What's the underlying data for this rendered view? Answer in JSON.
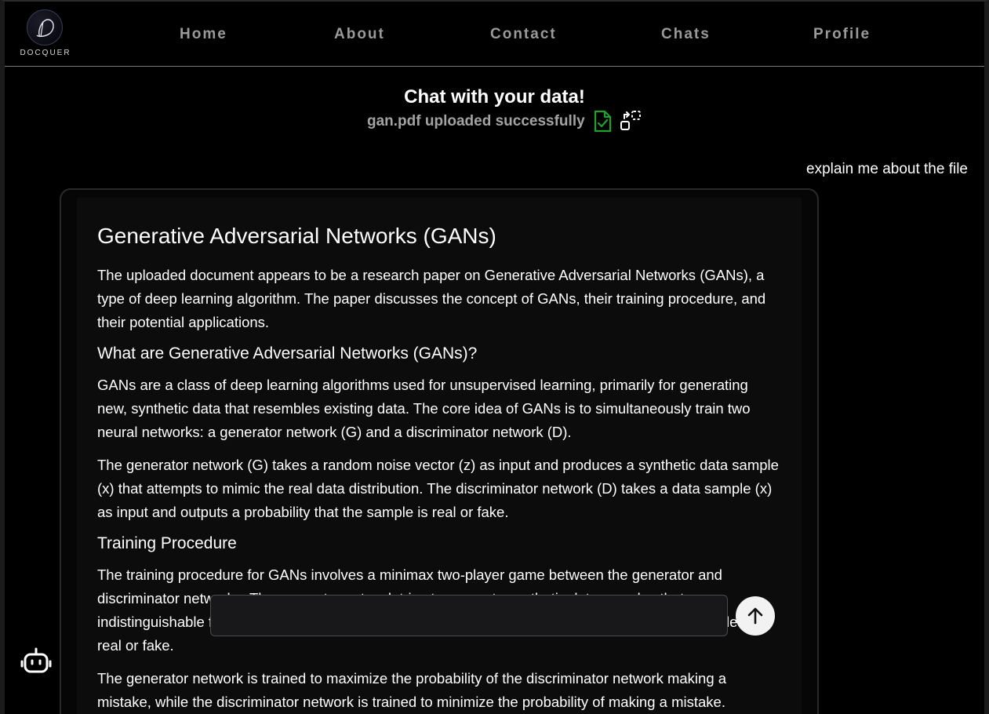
{
  "brand": {
    "name": "DOCQUER"
  },
  "nav": {
    "items": [
      {
        "label": "Home"
      },
      {
        "label": "About"
      },
      {
        "label": "Contact"
      },
      {
        "label": "Chats"
      },
      {
        "label": "Profile"
      }
    ]
  },
  "chat": {
    "title": "Chat with your data!",
    "upload_status": "gan.pdf uploaded successfully",
    "upload_icon": "file-check-icon",
    "change_file_icon": "swap-file-icon",
    "user_message": "explain me about the file",
    "input_placeholder": "",
    "send_icon": "arrow-up-icon",
    "bot_icon": "bot-icon"
  },
  "response": {
    "heading": "Generative Adversarial Networks (GANs)",
    "intro": "The uploaded document appears to be a research paper on Generative Adversarial Networks (GANs), a type of deep learning algorithm. The paper discusses the concept of GANs, their training procedure, and their potential applications.",
    "section1_title": "What are Generative Adversarial Networks (GANs)?",
    "section1_p1": "GANs are a class of deep learning algorithms used for unsupervised learning, primarily for generating new, synthetic data that resembles existing data. The core idea of GANs is to simultaneously train two neural networks: a generator network (G) and a discriminator network (D).",
    "section1_p2": "The generator network (G) takes a random noise vector (z) as input and produces a synthetic data sample (x) that attempts to mimic the real data distribution. The discriminator network (D) takes a data sample (x) as input and outputs a probability that the sample is real or fake.",
    "section2_title": "Training Procedure",
    "section2_p1": "The training procedure for GANs involves a minimax two-player game between the generator and discriminator networks. The generator network tries to generate synthetic data samples that are indistinguishable from real data, while the discriminator network tries to correctly classify the samples as real or fake.",
    "section2_p2": "The generator network is trained to maximize the probability of the discriminator network making a mistake, while the discriminator network is trained to minimize the probability of making a mistake."
  },
  "colors": {
    "background": "#000000",
    "nav_text": "#9a9a9a",
    "success_icon": "#1fa02f",
    "card_bg": "#0c0c0d"
  }
}
